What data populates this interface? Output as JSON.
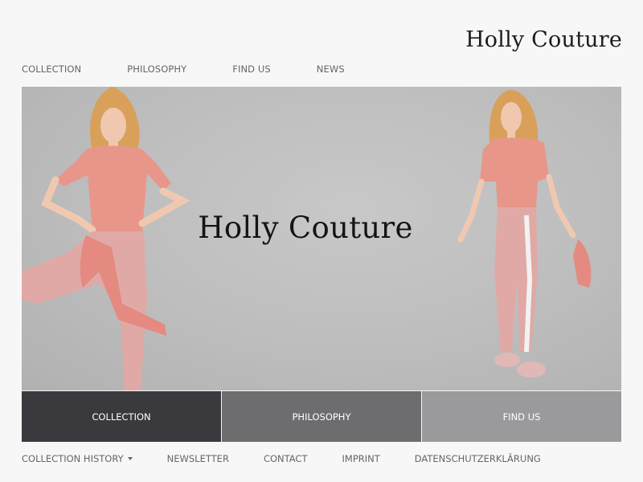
{
  "brand": {
    "name": "Holly Couture"
  },
  "top_nav": {
    "items": [
      "COLLECTION",
      "PHILOSOPHY",
      "FIND US",
      "NEWS"
    ]
  },
  "hero": {
    "title": "Holly Couture",
    "image_description": "two models in pink outfits"
  },
  "tiles": [
    {
      "label": "COLLECTION",
      "color": "#3a3a3e"
    },
    {
      "label": "PHILOSOPHY",
      "color": "#6d6d6f"
    },
    {
      "label": "FIND US",
      "color": "#9a9a9c"
    }
  ],
  "footer_nav": {
    "collection_history": "COLLECTION HISTORY",
    "items": [
      "NEWSLETTER",
      "CONTACT",
      "IMPRINT",
      "DATENSCHUTZERKLÄRUNG"
    ]
  },
  "colors": {
    "outfit_pink": "#e8968a",
    "hair": "#d9a05a",
    "skin": "#f0c8b0"
  }
}
